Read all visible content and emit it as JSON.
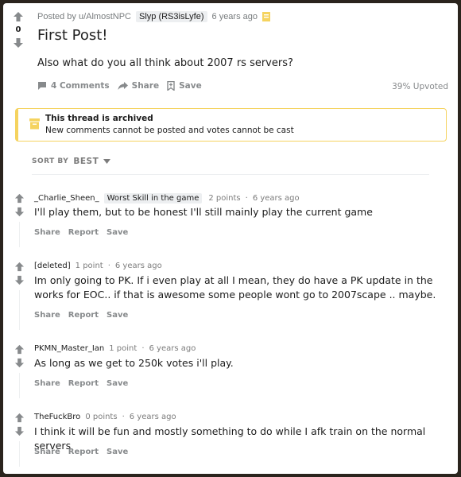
{
  "post": {
    "score": "0",
    "author": "Posted by u/AlmostNPC",
    "flair": "Slyp (RS3isLyfe)",
    "time": "6 years ago",
    "title": "First Post!",
    "body": "Also what do you all think about 2007 rs servers?",
    "comments_label": "4 Comments",
    "share_label": "Share",
    "save_label": "Save",
    "upvoted": "39% Upvoted"
  },
  "archived": {
    "title": "This thread is archived",
    "description": "New comments cannot be posted and votes cannot be cast"
  },
  "sort": {
    "label": "SORT BY",
    "value": "BEST"
  },
  "comments": [
    {
      "author": "_Charlie_Sheen_",
      "flair": "Worst Skill in the game",
      "points": "2 points",
      "dot": "·",
      "time": "6 years ago",
      "text": "I'll play them, but to be honest I'll still mainly play the current game",
      "share": "Share",
      "report": "Report",
      "save": "Save"
    },
    {
      "author": "[deleted]",
      "points": "1 point",
      "dot": "·",
      "time": "6 years ago",
      "text": "Im only going to PK. If i even play at all I mean, they do have a PK update in the works for EOC.. if that is awesome some people wont go to 2007scape .. maybe.",
      "share": "Share",
      "report": "Report",
      "save": "Save"
    },
    {
      "author": "PKMN_Master_Ian",
      "points": "1 point",
      "dot": "·",
      "time": "6 years ago",
      "text": "As long as we get to 250k votes i'll play.",
      "share": "Share",
      "report": "Report",
      "save": "Save"
    },
    {
      "author": "TheFuckBro",
      "points": "0 points",
      "dot": "·",
      "time": "6 years ago",
      "text": "I think it will be fun and mostly something to do while I afk train on the normal servers",
      "share": "Share",
      "report": "Report",
      "save": "Save"
    }
  ],
  "icons": {
    "upvote": "upvote-arrow-icon",
    "downvote": "downvote-arrow-icon",
    "comment": "comment-bubble-icon",
    "share": "share-arrow-icon",
    "save": "bookmark-icon",
    "archive": "archive-box-icon",
    "award": "award-icon",
    "sort": "caret-down-icon"
  },
  "colors": {
    "background": "#2a241d",
    "card": "#ffffff",
    "archived_border": "#f5d35f",
    "muted": "#878a8c"
  }
}
